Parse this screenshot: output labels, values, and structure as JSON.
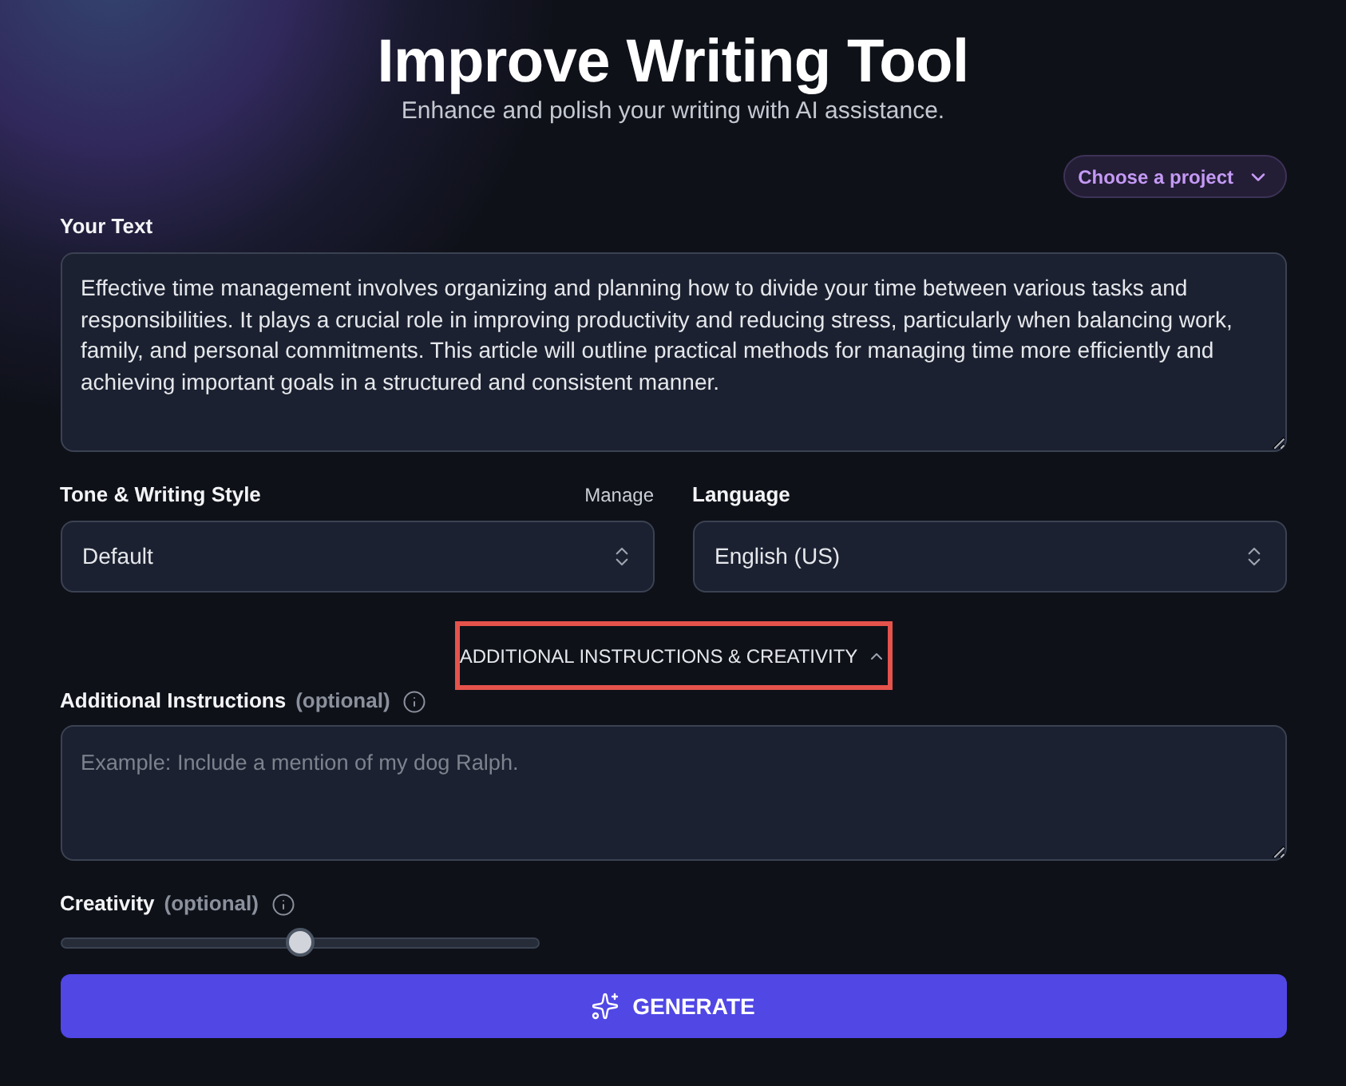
{
  "header": {
    "title": "Improve Writing Tool",
    "subtitle": "Enhance and polish your writing with AI assistance."
  },
  "project_picker": {
    "label": "Choose a project"
  },
  "your_text": {
    "label": "Your Text",
    "value": "Effective time management involves organizing and planning how to divide your time between various tasks and responsibilities. It plays a crucial role in improving productivity and reducing stress, particularly when balancing work, family, and personal commitments. This article will outline practical methods for managing time more efficiently and achieving important goals in a structured and consistent manner."
  },
  "tone": {
    "label": "Tone & Writing Style",
    "link": "Manage",
    "value": "Default"
  },
  "language": {
    "label": "Language",
    "value": "English (US)"
  },
  "advanced_toggle": {
    "label": "ADDITIONAL INSTRUCTIONS & CREATIVITY",
    "expanded": true,
    "highlighted": true
  },
  "instructions": {
    "label": "Additional Instructions",
    "hint": "(optional)",
    "placeholder": "Example: Include a mention of my dog Ralph."
  },
  "creativity": {
    "label": "Creativity",
    "hint": "(optional)",
    "level": 0.5
  },
  "generate_button": {
    "label": "GENERATE"
  }
}
